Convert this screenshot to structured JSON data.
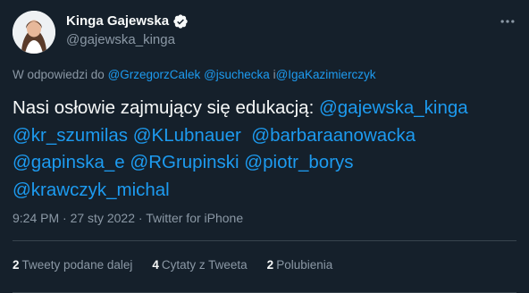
{
  "user": {
    "display_name": "Kinga Gajewska",
    "handle": "@gajewska_kinga",
    "verified_icon": "verified-badge-icon",
    "avatar_icon": "avatar-portrait"
  },
  "more_icon": "more-horizontal-icon",
  "reply": {
    "prefix": "W odpowiedzi do ",
    "m1": "@GrzegorzCalek",
    "sep1": " ",
    "m2": "@jsuchecka",
    "sep2": " i",
    "m3": "@IgaKazimierczyk"
  },
  "tweet": {
    "lead": "Nasi osłowie zajmujący się edukacją: ",
    "mentions": [
      "@gajewska_kinga",
      "@kr_szumilas",
      "@KLubnauer",
      "@barbaraanowacka",
      "@gapinska_e",
      "@RGrupinski",
      "@piotr_borys",
      "@krawczyk_michal"
    ]
  },
  "meta": {
    "time": "9:24 PM",
    "dot1": " · ",
    "date": "27 sty 2022",
    "dot2": " · ",
    "source": "Twitter for iPhone"
  },
  "stats": {
    "retweets_count": "2",
    "retweets_label": "Tweety podane dalej",
    "quotes_count": "4",
    "quotes_label": "Cytaty z Tweeta",
    "likes_count": "2",
    "likes_label": "Polubienia"
  },
  "colors": {
    "background": "#15202b",
    "accent": "#1d9bf0",
    "secondary_text": "#8b98a5",
    "primary_text": "#f7f9f9",
    "divider": "#38444d"
  }
}
